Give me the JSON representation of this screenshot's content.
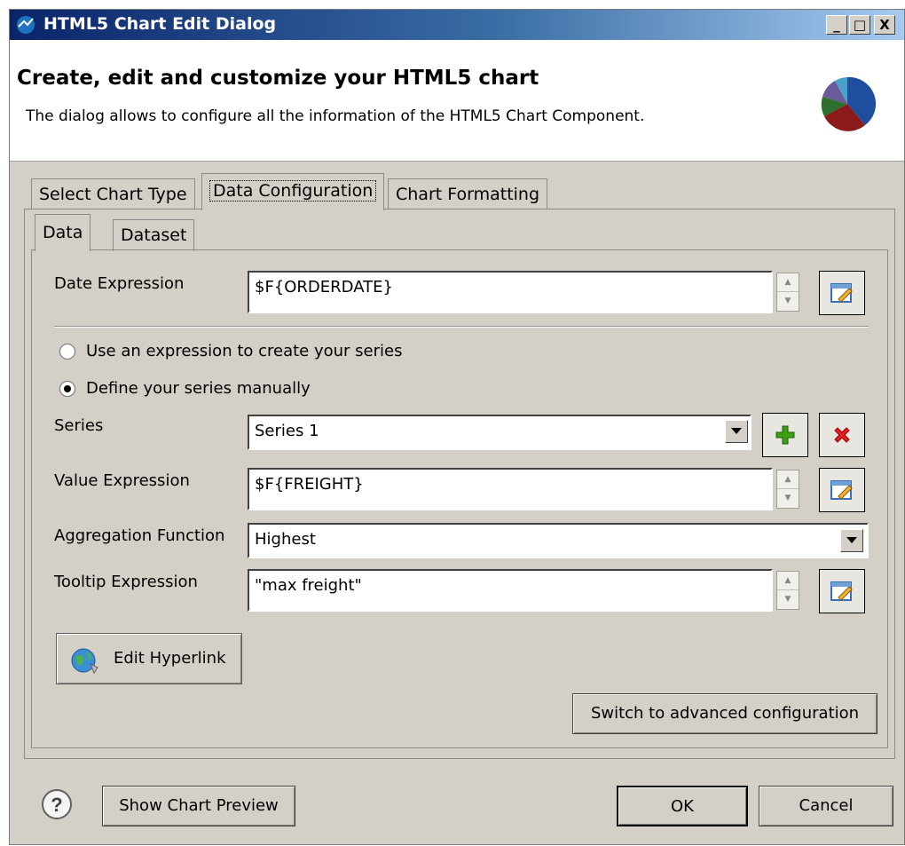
{
  "window": {
    "title": "HTML5 Chart Edit Dialog",
    "minimize": "_",
    "maximize": "□",
    "close": "X"
  },
  "header": {
    "title": "Create, edit and customize your HTML5 chart",
    "description": "The dialog allows to configure all the information of the HTML5 Chart Component.",
    "icon": "pie-chart-icon"
  },
  "tabs": [
    "Select Chart Type",
    "Data Configuration",
    "Chart Formatting"
  ],
  "active_tab": "Data Configuration",
  "subtabs": [
    "Data",
    "Dataset"
  ],
  "active_subtab": "Data",
  "form": {
    "date_expression_label": "Date Expression",
    "date_expression_value": "$F{ORDERDATE}",
    "radio_expression_label": "Use an expression to create your series",
    "radio_manual_label": "Define your series manually",
    "radio_selected": "manual",
    "series_label": "Series",
    "series_value": "Series 1",
    "value_expression_label": "Value Expression",
    "value_expression_value": "$F{FREIGHT}",
    "aggregation_label": "Aggregation Function",
    "aggregation_value": "Highest",
    "tooltip_label": "Tooltip Expression",
    "tooltip_value": "\"max freight\"",
    "edit_hyperlink_label": "Edit Hyperlink",
    "advanced_button_label": "Switch to advanced configuration"
  },
  "footer": {
    "help": "?",
    "preview_label": "Show Chart Preview",
    "ok_label": "OK",
    "cancel_label": "Cancel"
  },
  "colors": {
    "dialog_bg": "#d4d0c8",
    "add_icon": "#3aa012",
    "remove_icon": "#e02020",
    "pie_slices": [
      "#1f4e9e",
      "#8b1a1a",
      "#2e6e2e",
      "#6a5a9a",
      "#4aa0c8"
    ]
  }
}
